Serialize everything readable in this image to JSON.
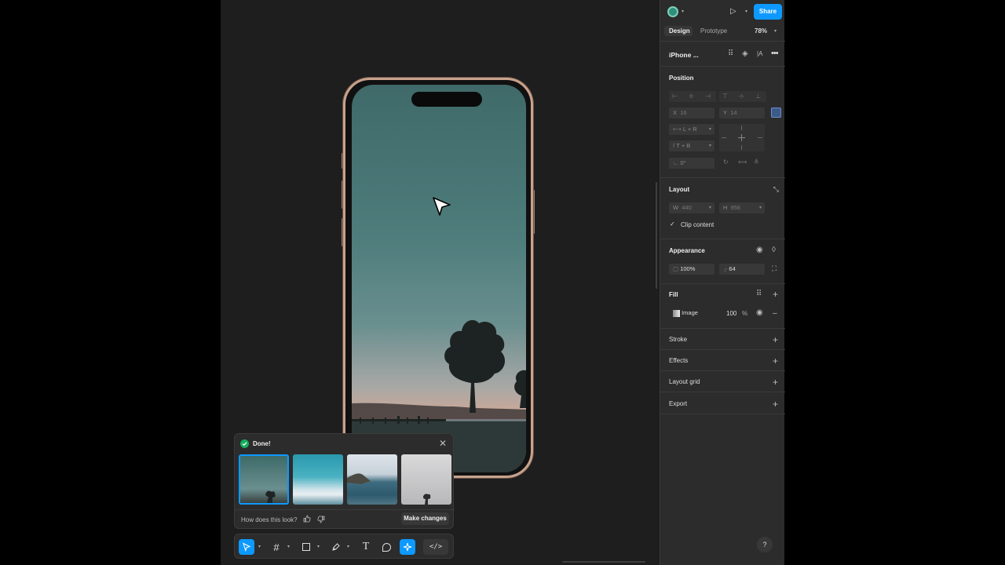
{
  "header": {
    "share_label": "Share",
    "tabs": [
      "Design",
      "Prototype"
    ],
    "zoom": "78%"
  },
  "layer": {
    "name": "iPhone ..."
  },
  "position": {
    "title": "Position",
    "x_label": "X",
    "x_value": "16",
    "y_label": "Y",
    "y_value": "14",
    "h_constraint": "L + R",
    "v_constraint": "T + B",
    "rotation": "0°"
  },
  "layout": {
    "title": "Layout",
    "w_label": "W",
    "w_value": "440",
    "h_label": "H",
    "h_value": "956",
    "clip_label": "Clip content",
    "clip_checked": true
  },
  "appearance": {
    "title": "Appearance",
    "opacity": "100%",
    "radius": "64"
  },
  "fill": {
    "title": "Fill",
    "type": "Image",
    "opacity": "100",
    "percent": "%"
  },
  "sections": [
    "Stroke",
    "Effects",
    "Layout grid",
    "Export"
  ],
  "popup": {
    "status": "Done!",
    "feedback_question": "How does this look?",
    "make_changes": "Make changes"
  },
  "help_label": "?",
  "colors": {
    "accent": "#0d99ff",
    "success": "#14ae5c",
    "panel": "#2c2c2c",
    "canvas": "#1e1e1e",
    "phone_frame": "#c7a28d"
  }
}
